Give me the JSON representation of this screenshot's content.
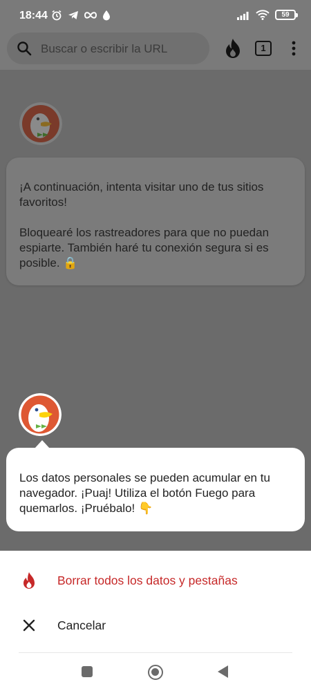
{
  "status_bar": {
    "time": "18:44",
    "battery": "59",
    "left_icons": [
      "alarm-icon",
      "telegram-icon",
      "infinity-icon",
      "drop-icon"
    ],
    "right_icons": [
      "signal-icon",
      "wifi-icon",
      "battery-icon"
    ]
  },
  "toolbar": {
    "search_placeholder": "Buscar o escribir la URL",
    "tab_count": "1"
  },
  "onboarding": {
    "previous_message": {
      "paragraph1": "¡A continuación, intenta visitar uno de tus sitios favoritos!",
      "paragraph2": "Bloquearé los rastreadores para que no puedan espiarte. También haré tu conexión segura si es posible. 🔒"
    },
    "current_message": "Los datos personales se pueden acumular en tu navegador. ¡Puaj! Utiliza el botón Fuego para quemarlos. ¡Pruébalo! 👇"
  },
  "fire_sheet": {
    "burn_label": "Borrar todos los datos y pestañas",
    "cancel_label": "Cancelar"
  },
  "colors": {
    "accent_red": "#c62828",
    "scrim": "#6b6b6b",
    "duck_orange": "#de5833"
  }
}
